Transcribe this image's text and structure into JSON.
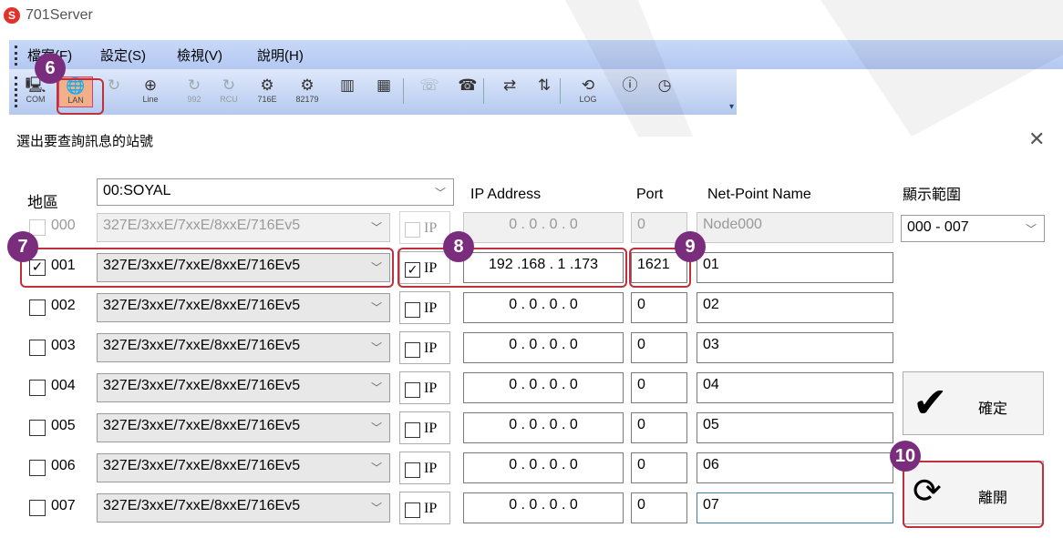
{
  "app": {
    "title": "701Server",
    "icon": "soyal-logo-icon"
  },
  "menu": [
    "檔案(F)",
    "設定(S)",
    "檢視(V)",
    "說明(H)"
  ],
  "toolbar": [
    {
      "name": "com",
      "label": "COM",
      "icon": "monitor-icon",
      "enabled": true
    },
    {
      "name": "lan",
      "label": "LAN",
      "icon": "globe-icon",
      "enabled": true,
      "active": true
    },
    {
      "name": "refresh",
      "label": "",
      "icon": "refresh-icon",
      "enabled": false
    },
    {
      "name": "line",
      "label": "Line",
      "icon": "line-icon",
      "enabled": true
    },
    {
      "name": "992",
      "label": "992",
      "icon": "sync-icon",
      "enabled": false
    },
    {
      "name": "rcu",
      "label": "RCU",
      "icon": "sync-icon",
      "enabled": false
    },
    {
      "name": "716e",
      "label": "716E",
      "icon": "device-gear-icon",
      "enabled": true
    },
    {
      "name": "82179",
      "label": "82179",
      "icon": "device-gear-icon",
      "enabled": true
    },
    {
      "name": "h",
      "label": "",
      "icon": "hardware-h-icon",
      "enabled": true
    },
    {
      "name": "e",
      "label": "",
      "icon": "calculator-e-icon",
      "enabled": true
    },
    {
      "name": "call",
      "label": "",
      "icon": "phone-icon",
      "enabled": false
    },
    {
      "name": "download",
      "label": "",
      "icon": "download-phone-icon",
      "enabled": true
    },
    {
      "name": "sync2",
      "label": "",
      "icon": "exchange-icon",
      "enabled": true
    },
    {
      "name": "updown",
      "label": "",
      "icon": "up-down-icon",
      "enabled": true
    },
    {
      "name": "log",
      "label": "LOG",
      "icon": "log-icon",
      "enabled": true
    },
    {
      "name": "info",
      "label": "",
      "icon": "info-icon",
      "enabled": true
    },
    {
      "name": "clock",
      "label": "",
      "icon": "clock-download-icon",
      "enabled": true
    }
  ],
  "dialog": {
    "title": "選出要查詢訊息的站號",
    "area_label": "地區",
    "area_value": "00:SOYAL",
    "headers": {
      "ip": "IP Address",
      "port": "Port",
      "name": "Net-Point Name",
      "range": "顯示範圍"
    },
    "range_value": "000 - 007",
    "ok_label": "確定",
    "exit_label": "離開",
    "rows": [
      {
        "id": "000",
        "checked": false,
        "disabled": true,
        "model": "327E/3xxE/7xxE/8xxE/716Ev5",
        "ip_checked": false,
        "ip": "0 . 0 . 0 . 0",
        "port": "0",
        "name": "Node000"
      },
      {
        "id": "001",
        "checked": true,
        "disabled": false,
        "model": "327E/3xxE/7xxE/8xxE/716Ev5",
        "ip_checked": true,
        "ip": "192 .168 . 1 .173",
        "port": "1621",
        "name": "01"
      },
      {
        "id": "002",
        "checked": false,
        "disabled": false,
        "model": "327E/3xxE/7xxE/8xxE/716Ev5",
        "ip_checked": false,
        "ip": "0 . 0 . 0 . 0",
        "port": "0",
        "name": "02"
      },
      {
        "id": "003",
        "checked": false,
        "disabled": false,
        "model": "327E/3xxE/7xxE/8xxE/716Ev5",
        "ip_checked": false,
        "ip": "0 . 0 . 0 . 0",
        "port": "0",
        "name": "03"
      },
      {
        "id": "004",
        "checked": false,
        "disabled": false,
        "model": "327E/3xxE/7xxE/8xxE/716Ev5",
        "ip_checked": false,
        "ip": "0 . 0 . 0 . 0",
        "port": "0",
        "name": "04"
      },
      {
        "id": "005",
        "checked": false,
        "disabled": false,
        "model": "327E/3xxE/7xxE/8xxE/716Ev5",
        "ip_checked": false,
        "ip": "0 . 0 . 0 . 0",
        "port": "0",
        "name": "05"
      },
      {
        "id": "006",
        "checked": false,
        "disabled": false,
        "model": "327E/3xxE/7xxE/8xxE/716Ev5",
        "ip_checked": false,
        "ip": "0 . 0 . 0 . 0",
        "port": "0",
        "name": "06"
      },
      {
        "id": "007",
        "checked": false,
        "disabled": false,
        "model": "327E/3xxE/7xxE/8xxE/716Ev5",
        "ip_checked": false,
        "ip": "0 . 0 . 0 . 0",
        "port": "0",
        "name": "07"
      }
    ]
  },
  "annotations": [
    "6",
    "7",
    "8",
    "9",
    "10"
  ],
  "colors": {
    "highlight": "#c0303a",
    "badge": "#7b2d7d",
    "menubar": "#c8d8f8"
  }
}
